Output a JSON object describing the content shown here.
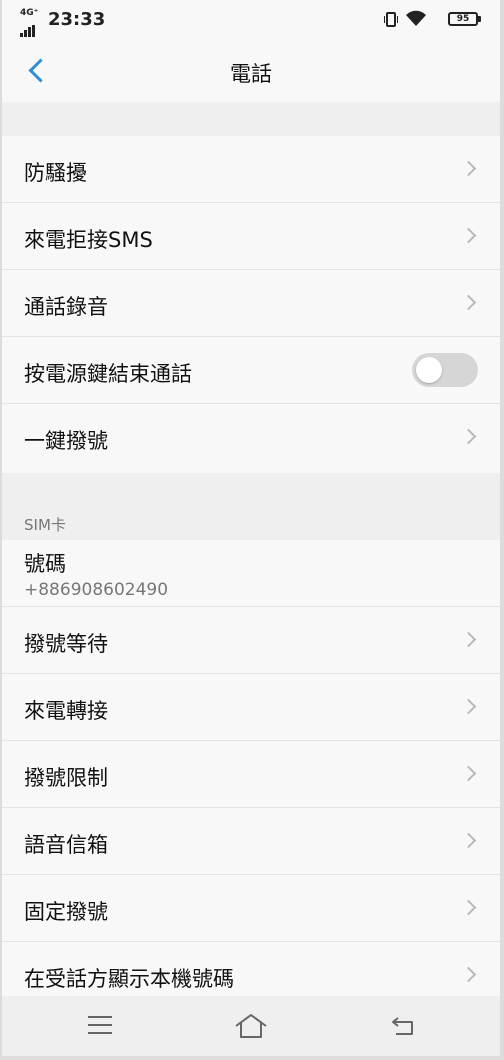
{
  "status_bar": {
    "network": "4G⁺",
    "time": "23:33",
    "battery": "95"
  },
  "header": {
    "title": "電話"
  },
  "group1": {
    "items": [
      {
        "label": "防騷擾"
      },
      {
        "label": "來電拒接SMS"
      },
      {
        "label": "通話錄音"
      },
      {
        "label": "按電源鍵結束通話",
        "toggle": false
      },
      {
        "label": "一鍵撥號"
      }
    ]
  },
  "sim_section": {
    "label": "SIM卡",
    "number_label": "號碼",
    "number_value": "+886908602490",
    "items": [
      {
        "label": "撥號等待"
      },
      {
        "label": "來電轉接"
      },
      {
        "label": "撥號限制"
      },
      {
        "label": "語音信箱"
      },
      {
        "label": "固定撥號"
      },
      {
        "label": "在受話方顯示本機號碼"
      }
    ]
  },
  "colors": {
    "accent": "#2f8ed8",
    "background": "#f8f8f8",
    "section_gap": "#efefef"
  },
  "icons": {
    "back": "back-arrow-icon",
    "chevron": "chevron-right-icon",
    "nav_menu": "menu-icon",
    "nav_home": "home-icon",
    "nav_back": "return-icon"
  }
}
